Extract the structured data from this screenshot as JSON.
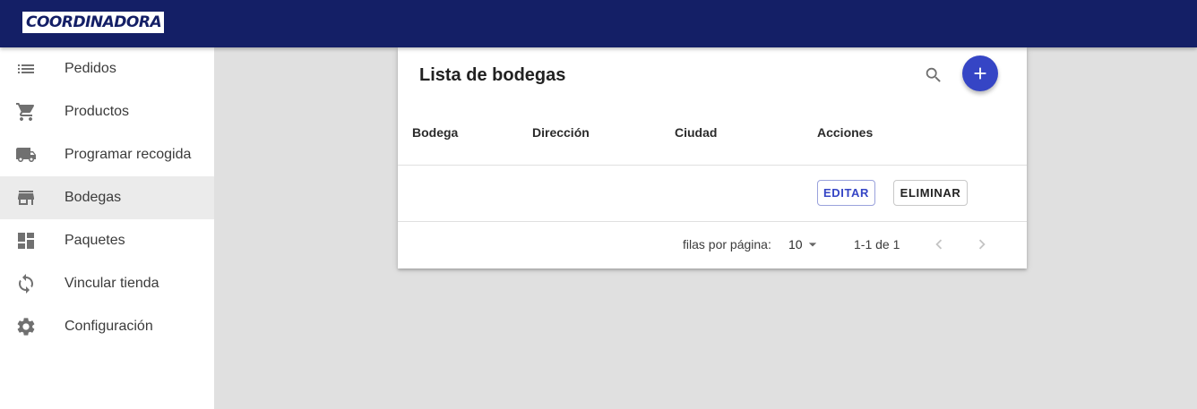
{
  "app": {
    "logo_text": "COORDINADORA"
  },
  "sidebar": {
    "items": [
      {
        "label": "Pedidos",
        "icon": "list-icon",
        "active": false
      },
      {
        "label": "Productos",
        "icon": "shopping-cart-icon",
        "active": false
      },
      {
        "label": "Programar recogida",
        "icon": "truck-icon",
        "active": false
      },
      {
        "label": "Bodegas",
        "icon": "store-icon",
        "active": true
      },
      {
        "label": "Paquetes",
        "icon": "dashboard-icon",
        "active": false
      },
      {
        "label": "Vincular tienda",
        "icon": "sync-icon",
        "active": false
      },
      {
        "label": "Configuración",
        "icon": "gear-icon",
        "active": false
      }
    ]
  },
  "card": {
    "title": "Lista de bodegas",
    "columns": [
      "Bodega",
      "Dirección",
      "Ciudad",
      "Acciones"
    ],
    "rows": [
      {
        "bodega": "",
        "direccion": "",
        "ciudad": "",
        "actions": {
          "edit": "EDITAR",
          "delete": "ELIMINAR"
        }
      }
    ],
    "footer": {
      "rows_per_page_label": "filas por página:",
      "rows_per_page_value": "10",
      "range_text": "1-1 de 1"
    }
  },
  "colors": {
    "topbar": "#141f66",
    "accent": "#3545c5",
    "background": "#e0e0e0",
    "active_item": "#ebebeb"
  }
}
